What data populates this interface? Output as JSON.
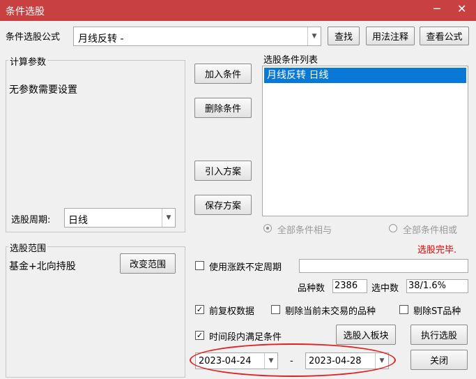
{
  "window": {
    "title": "条件选股",
    "minimize": "─",
    "close": "✕"
  },
  "formula": {
    "label": "条件选股公式",
    "value": "月线反转    -",
    "find": "查找",
    "usage": "用法注释",
    "view": "查看公式"
  },
  "params": {
    "legend": "计算参数",
    "text": "无参数需要设置",
    "period_label": "选股周期:",
    "period_value": "日线"
  },
  "actions": {
    "add": "加入条件",
    "delete": "删除条件",
    "import": "引入方案",
    "save": "保存方案"
  },
  "conditions": {
    "legend": "选股条件列表",
    "items": [
      "月线反转  日线"
    ]
  },
  "logic": {
    "and_label": "全部条件相与",
    "or_label": "全部条件相或"
  },
  "status": {
    "text": "选股完毕.",
    "color": "#e00000"
  },
  "range": {
    "legend": "选股范围",
    "text": "基金+北向持股",
    "change": "改变范围"
  },
  "options": {
    "variable_period": "使用涨跌不定周期",
    "count_label": "品种数",
    "count_value": "2386",
    "selected_label": "选中数",
    "selected_value": "38/1.6%",
    "adjust": "前复权数据",
    "exclude_untraded": "剔除当前未交易的品种",
    "exclude_st": "剔除ST品种",
    "time_range": "时间段内满足条件"
  },
  "buttons": {
    "to_block": "选股入板块",
    "execute": "执行选股",
    "close": "关闭"
  },
  "dates": {
    "start": "2023-04-24",
    "separator": "-",
    "end": "2023-04-28"
  }
}
